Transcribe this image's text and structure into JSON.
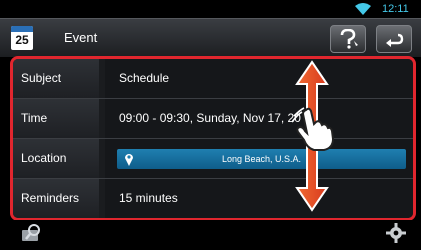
{
  "status": {
    "time": "12:11"
  },
  "header": {
    "app_icon_day": "25",
    "title": "Event",
    "help_icon": "help-icon",
    "back_icon": "back-icon"
  },
  "rows": [
    {
      "label": "Subject",
      "value": "Schedule"
    },
    {
      "label": "Time",
      "value": "09:00 - 09:30, Sunday, Nov 17, 20"
    },
    {
      "label": "Location",
      "value": "Long Beach, U.S.A."
    },
    {
      "label": "Reminders",
      "value": "15 minutes"
    }
  ],
  "colors": {
    "highlight_border": "#e0262e",
    "location_bar": "#1f7fb0",
    "clock": "#44c8e8"
  },
  "footer": {
    "left_icon": "search-icon",
    "right_icon": "gear-icon"
  }
}
